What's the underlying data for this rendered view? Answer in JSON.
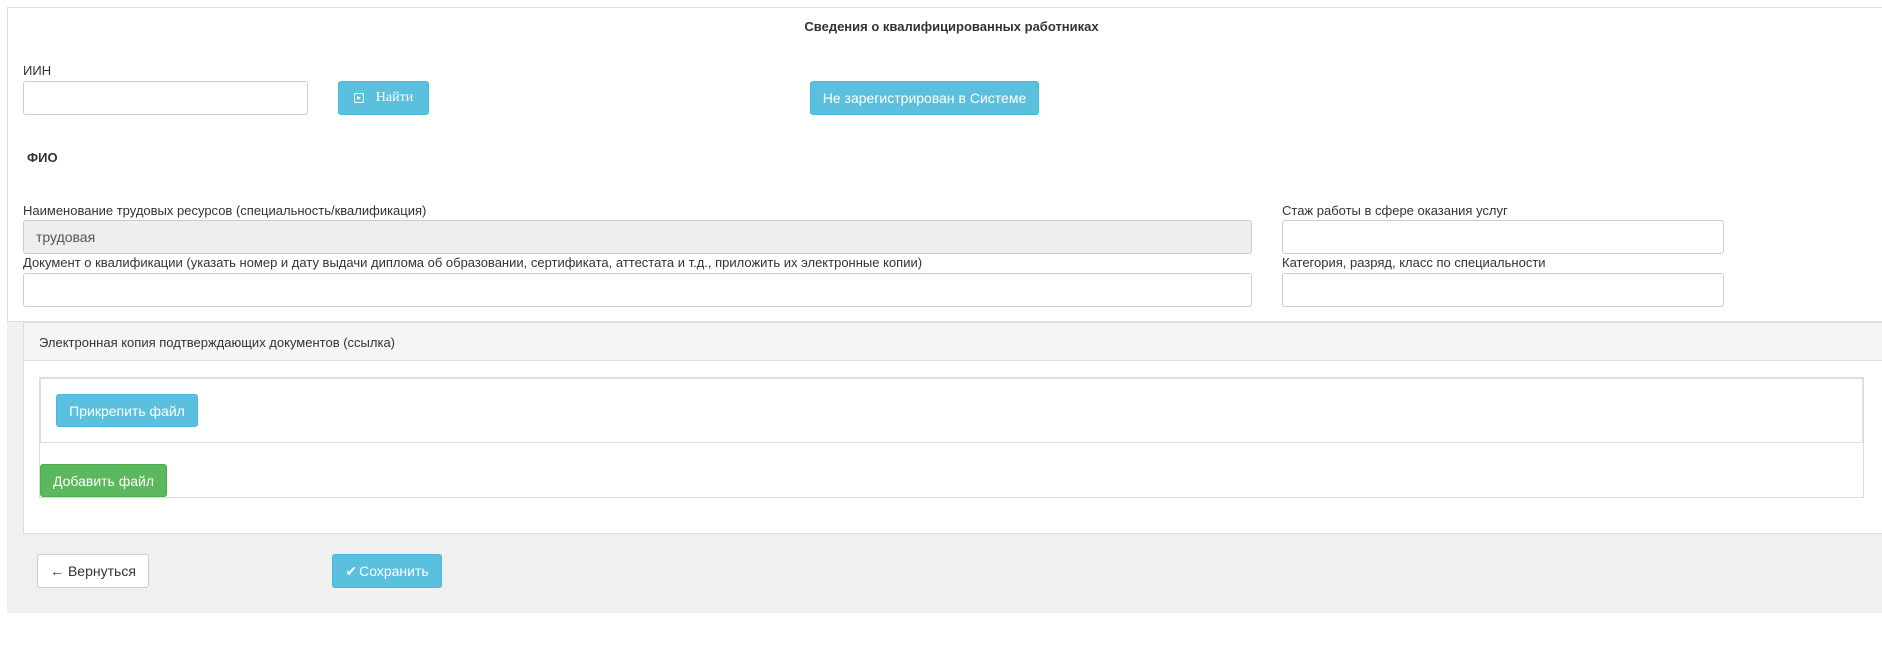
{
  "header": {
    "title": "Сведения о квалифицированных работниках"
  },
  "iin": {
    "label": "ИИН",
    "value": "",
    "find_label": "Найти",
    "find_icon": "play-square-icon",
    "not_registered_label": "Не зарегистрирован в Системе"
  },
  "fio": {
    "label": "ФИО"
  },
  "fields": {
    "resource_name": {
      "label": "Наименование трудовых ресурсов (специальность/квалификация)",
      "value": "трудовая"
    },
    "experience": {
      "label": "Стаж работы в сфере оказания услуг",
      "value": ""
    },
    "document": {
      "label": "Документ о квалификации (указать номер и дату выдачи диплома об образовании, сертификата, аттестата и т.д., приложить их электронные копии)",
      "value": ""
    },
    "category": {
      "label": "Категория, разряд, класс по специальности",
      "value": ""
    }
  },
  "attachments": {
    "heading": "Электронная копия подтверждающих документов (ссылка)",
    "attach_label": "Прикрепить файл",
    "add_label": "Добавить файл"
  },
  "footer": {
    "back_label": "← Вернуться",
    "save_icon": "✔",
    "save_label": "Сохранить"
  },
  "colors": {
    "info": "#5bc0de",
    "success": "#5cb85c",
    "readonly_bg": "#eeeeee",
    "panel_grey": "#f0f0f0"
  }
}
